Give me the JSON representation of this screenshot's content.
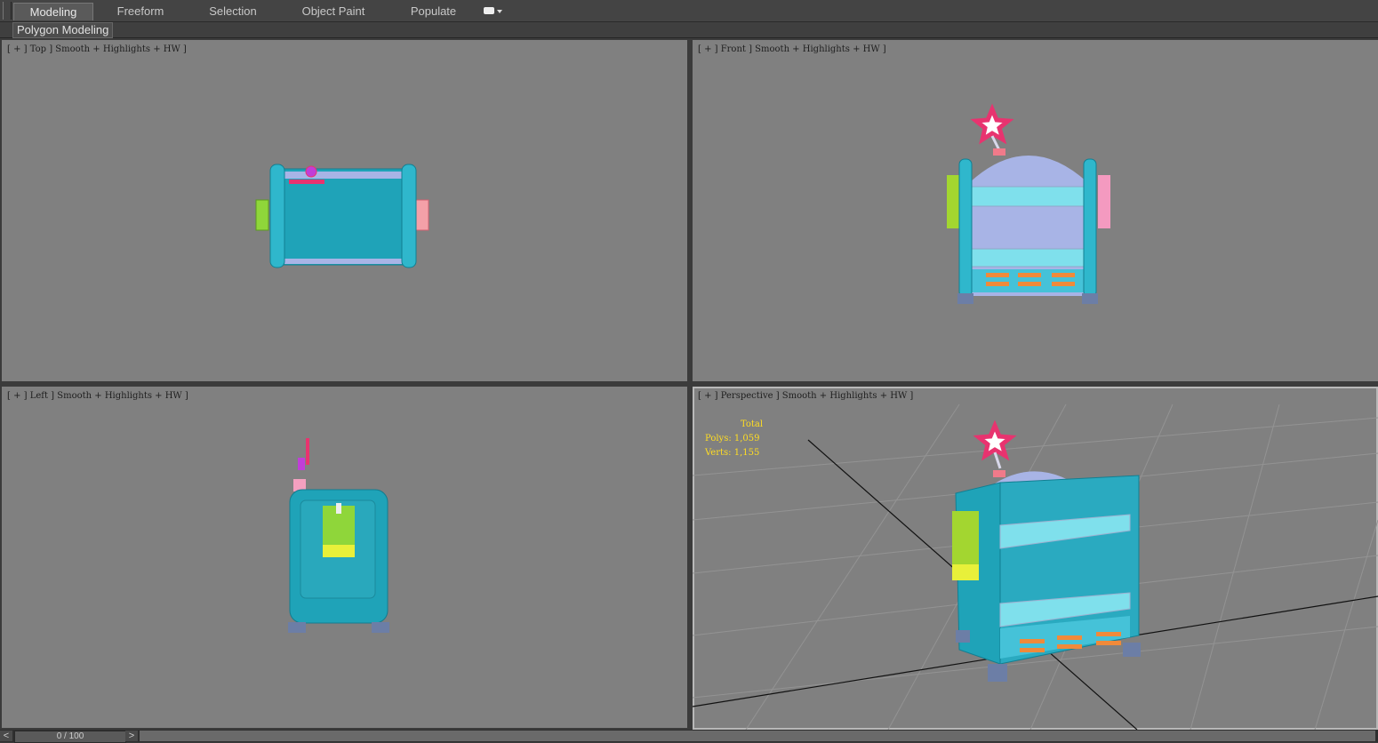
{
  "ribbon": {
    "tabs": [
      {
        "label": "Modeling",
        "active": true
      },
      {
        "label": "Freeform",
        "active": false
      },
      {
        "label": "Selection",
        "active": false
      },
      {
        "label": "Object Paint",
        "active": false
      },
      {
        "label": "Populate",
        "active": false
      }
    ],
    "dropdown_icon": "toggle-dropdown-icon"
  },
  "subribbon": {
    "label": "Polygon Modeling"
  },
  "viewports": {
    "top": {
      "label": "[ + ] Top ] Smooth + Highlights + HW ]"
    },
    "front": {
      "label": "[ + ] Front ] Smooth + Highlights + HW ]"
    },
    "left": {
      "label": "[ + ] Left ] Smooth + Highlights + HW ]"
    },
    "perspective": {
      "label": "[ + ] Perspective ] Smooth + Highlights + HW ]",
      "stats": {
        "title": "Total",
        "polys": "Polys: 1,059",
        "verts": "Verts: 1,155"
      }
    }
  },
  "timeline": {
    "prev": "<",
    "frame": "0 / 100",
    "next": ">"
  },
  "colors": {
    "viewport_bg": "#808080",
    "teal": "#29a3b8",
    "lavender": "#a8b4e6",
    "pink_star": "#e8336f",
    "stats_yellow": "#ffdd22"
  }
}
